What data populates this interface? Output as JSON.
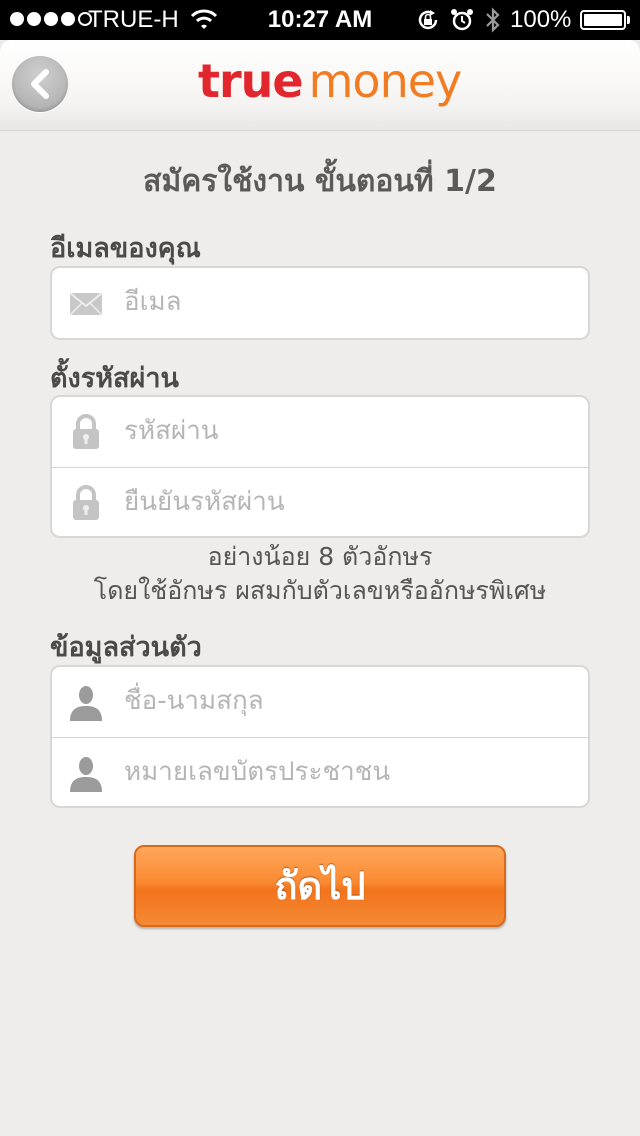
{
  "status_bar": {
    "carrier": "TRUE-H",
    "time": "10:27 AM",
    "battery": "100%"
  },
  "header": {
    "logo_true": "true",
    "logo_money": "money"
  },
  "page": {
    "title": "สมัครใช้งาน ขั้นตอนที่ 1/2"
  },
  "email_section": {
    "label": "อีเมลของคุณ",
    "email_placeholder": "อีเมล",
    "email_value": ""
  },
  "password_section": {
    "label": "ตั้งรหัสผ่าน",
    "password_placeholder": "รหัสผ่าน",
    "confirm_placeholder": "ยืนยันรหัสผ่าน",
    "hint_line1": "อย่างน้อย 8 ตัวอักษร",
    "hint_line2": "โดยใช้อักษร ผสมกับตัวเลขหรืออักษรพิเศษ"
  },
  "personal_section": {
    "label": "ข้อมูลส่วนตัว",
    "name_placeholder": "ชื่อ-นามสกุล",
    "id_placeholder": "หมายเลขบัตรประชาชน"
  },
  "actions": {
    "next_label": "ถัดไป"
  },
  "colors": {
    "brand_red": "#e1262d",
    "brand_orange": "#f27c21",
    "button_orange": "#f58a35",
    "background": "#efedeb"
  }
}
